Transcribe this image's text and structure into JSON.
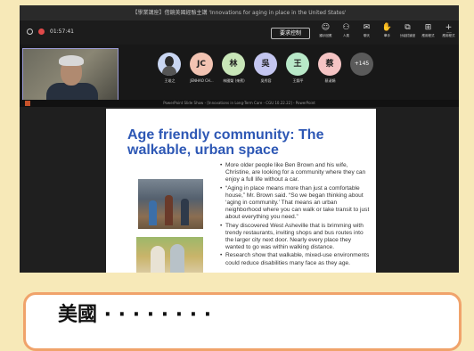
{
  "window": {
    "title": "【學業講座】借鏡美國經驗主講 'Innovations for aging in place in the United States'"
  },
  "toolbar": {
    "timer": "01:57:41",
    "share_button": "要求控制",
    "actions": [
      {
        "icon": "☺",
        "label": "顯示回應"
      },
      {
        "icon": "⚇",
        "label": "人員"
      },
      {
        "icon": "✉",
        "label": "聊天"
      },
      {
        "icon": "✋",
        "label": "舉手"
      },
      {
        "icon": "⧉",
        "label": "分組討論室"
      },
      {
        "icon": "⊞",
        "label": "應用程式"
      },
      {
        "icon": "+",
        "label": "應用程式"
      },
      {
        "icon": "···",
        "label": "更多"
      }
    ]
  },
  "participants": [
    {
      "initials": "",
      "name": "王竣之",
      "color": "#c9d6f2"
    },
    {
      "initials": "JC",
      "name": "JENHAO CH...",
      "color": "#f2c3b2"
    },
    {
      "initials": "林",
      "name": "林國榮 (來賓)",
      "color": "#c8e6b8"
    },
    {
      "initials": "吳",
      "name": "吳秀容",
      "color": "#c4c6f0"
    },
    {
      "initials": "王",
      "name": "王錦平",
      "color": "#b8e8c8"
    },
    {
      "initials": "蔡",
      "name": "蔡淑娟",
      "color": "#f5c4c4"
    }
  ],
  "more_participants": "+145",
  "self_name": "...",
  "ppt_bar": "PowerPoint Slide Show - [Innovations in Long-Term Care - CGU 10.22.22] - PowerPoint",
  "slide": {
    "title": "Age friendly community: The walkable, urban space",
    "bullets": [
      "More older people like Ben Brown and his wife, Christine, are looking for a community where they can enjoy a full life without a car.",
      "“Aging in place means more than just a comfortable house,” Mr. Brown said. “So we began thinking about ‘aging in community.’ That means an urban neighborhood where you can walk or take transit to just about everything you need.”",
      "They discovered West Asheville that is brimming with trendy restaurants, inviting shops and bus routes into the larger city next door. Nearly every place they wanted to go was within walking distance.",
      "Research show that walkable, mixed-use environments could reduce disabilities many face as they age."
    ]
  },
  "caption": "美國 · · · · · · · ·",
  "colors": {
    "background": "#f7e9b8",
    "accent_title": "#2e58b5",
    "card_border": "#f0a36b"
  }
}
